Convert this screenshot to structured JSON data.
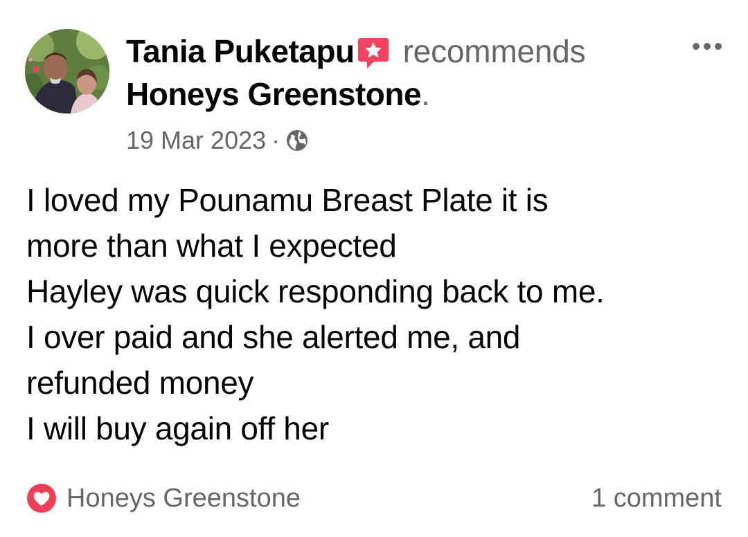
{
  "post": {
    "author": "Tania Puketapu",
    "action": "recommends",
    "page_name": "Honeys Greenstone",
    "period": ".",
    "date": "19 Mar 2023",
    "separator": "·",
    "privacy_icon": "globe-icon",
    "recommend_icon": "recommend-star-badge-icon",
    "more_icon": "more-options-icon",
    "body_lines": [
      "I loved my Pounamu Breast Plate it is",
      "more than what I expected",
      "Hayley was quick responding back to me.",
      "I over paid and she alerted me, and",
      "refunded money",
      "I will buy again off her"
    ]
  },
  "footer": {
    "reaction_icon": "heart-badge-icon",
    "page_name": "Honeys Greenstone",
    "comments": "1 comment"
  },
  "colors": {
    "text_primary": "#050505",
    "text_secondary": "#65676b",
    "recommend_badge": "#f3425f",
    "heart_badge": "#f33e58"
  }
}
